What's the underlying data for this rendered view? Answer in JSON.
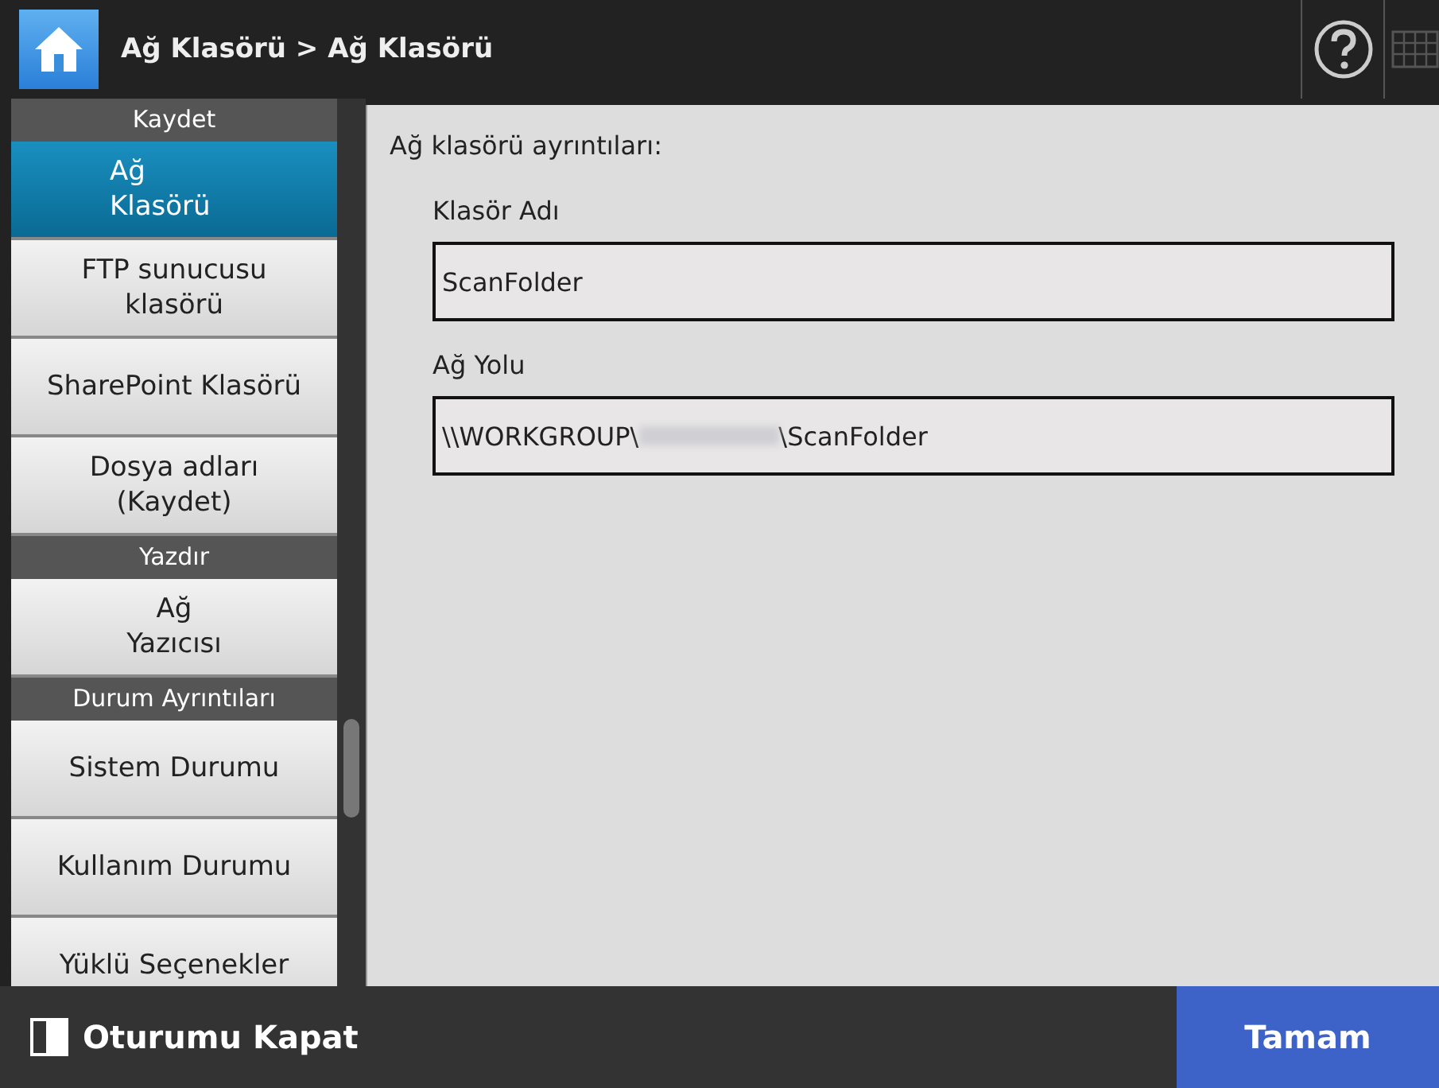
{
  "header": {
    "breadcrumb": "Ağ Klasörü > Ağ Klasörü"
  },
  "sidebar": {
    "items": [
      {
        "kind": "header",
        "label": "Kaydet"
      },
      {
        "kind": "item",
        "label": "Ağ\nKlasörü",
        "selected": true
      },
      {
        "kind": "item",
        "label": "FTP sunucusu\nklasörü",
        "selected": false
      },
      {
        "kind": "item",
        "label": "SharePoint Klasörü",
        "selected": false
      },
      {
        "kind": "item",
        "label": "Dosya adları\n(Kaydet)",
        "selected": false
      },
      {
        "kind": "header",
        "label": "Yazdır"
      },
      {
        "kind": "item",
        "label": "Ağ\nYazıcısı",
        "selected": false
      },
      {
        "kind": "header",
        "label": "Durum Ayrıntıları"
      },
      {
        "kind": "item",
        "label": "Sistem Durumu",
        "selected": false
      },
      {
        "kind": "item",
        "label": "Kullanım Durumu",
        "selected": false
      },
      {
        "kind": "item",
        "label": "Yüklü Seçenekler",
        "selected": false
      }
    ]
  },
  "content": {
    "heading": "Ağ klasörü ayrıntıları:",
    "fields": [
      {
        "label": "Klasör Adı",
        "value": "ScanFolder",
        "redacted": false
      },
      {
        "label": "Ağ Yolu",
        "value": "\\\\WORKGROUP\\",
        "value_after": "\\ScanFolder",
        "redacted": true
      }
    ]
  },
  "footer": {
    "logout": "Oturumu Kapat",
    "ok": "Tamam"
  }
}
